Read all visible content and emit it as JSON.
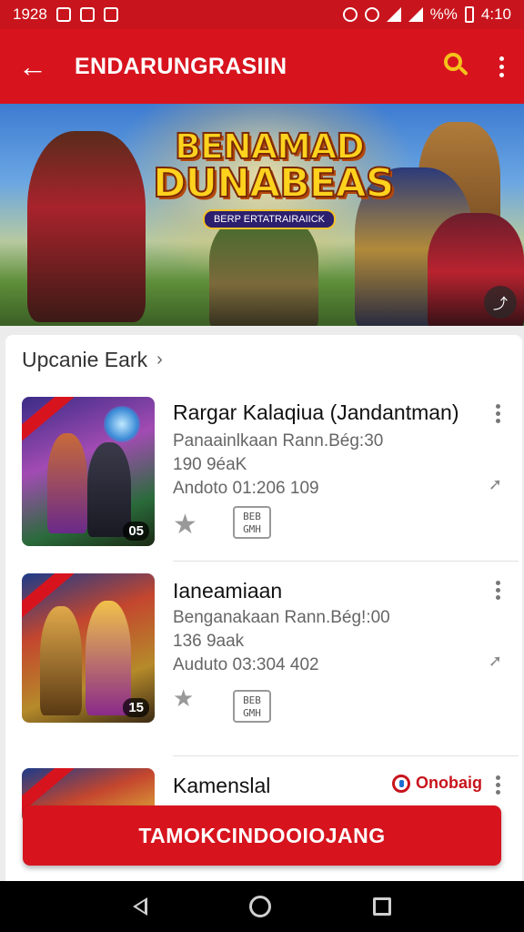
{
  "status_bar": {
    "time_left": "1928",
    "time_right": "4:10",
    "battery_text": "%%"
  },
  "app_bar": {
    "title": "ENDARUNGRASIIN",
    "back_icon": "back-arrow-icon",
    "search_icon": "search-icon",
    "menu_icon": "overflow-menu-icon"
  },
  "banner": {
    "logo_line1": "BENAMAD",
    "logo_line2": "DUNABEAS",
    "logo_sub": "BERP ERTATRAIRAIICK"
  },
  "section": {
    "title": "Upcanie Eark",
    "chevron": "›"
  },
  "games": [
    {
      "title": "Rargar Kalaqiua (Jandantman)",
      "line1": "Panaainlkaan Rann.Bég:30",
      "line2": "190 9éaK",
      "line3": "Andoto  01:206 109",
      "thumb_badge": "05",
      "mini_badge": "BEB GMH"
    },
    {
      "title": "Ianeamiaan",
      "line1": "Benganakaan Rann.Bég!:00",
      "line2": "136 9aak",
      "line3": "Auduto  03:304 402",
      "thumb_badge": "15",
      "mini_badge": "BEB GMH"
    },
    {
      "title": "Kamenslal",
      "brand": "Onobaig"
    }
  ],
  "cta": {
    "label": "TAMOKCINDOOIOJANG"
  },
  "colors": {
    "primary_red": "#d7141e",
    "accent_yellow": "#f5c21b"
  }
}
